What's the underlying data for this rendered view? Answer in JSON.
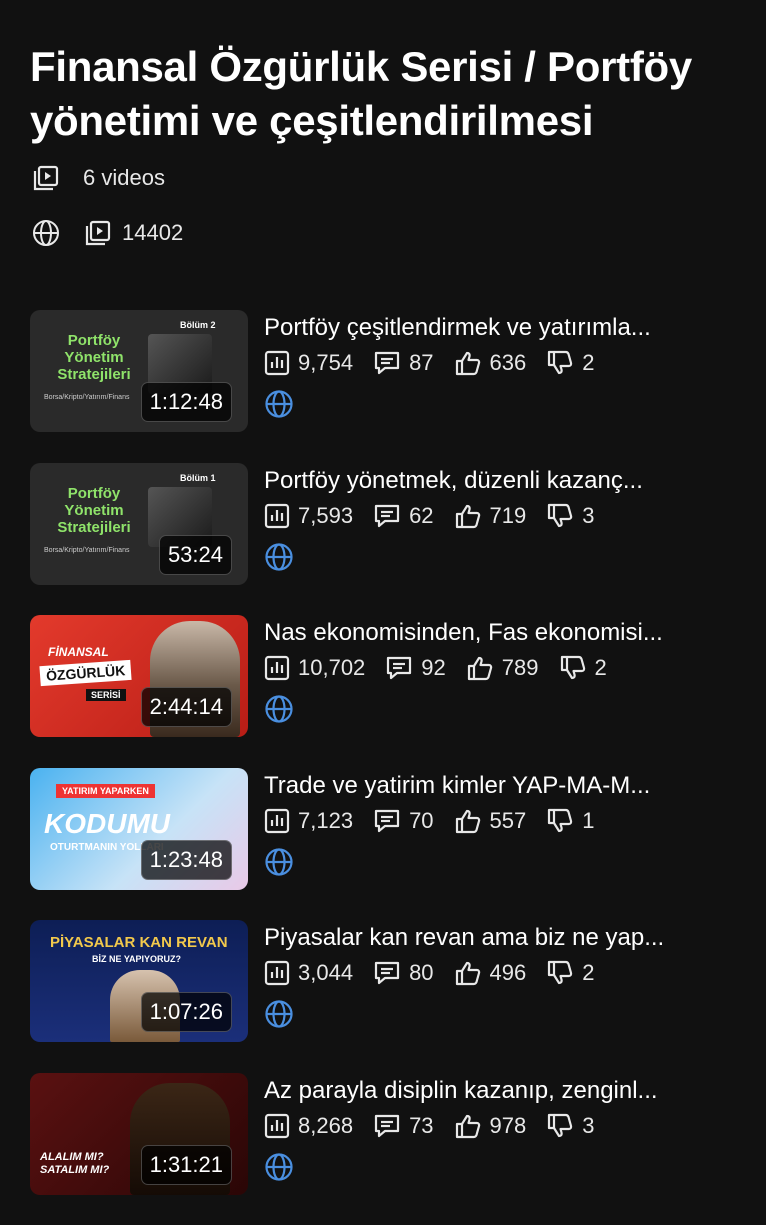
{
  "playlist": {
    "title": "Finansal Özgürlük Serisi / Portföy yönetimi ve çeşitlendirilmesi",
    "video_count": "6 videos",
    "total_views": "14402"
  },
  "colors": {
    "background": "#111111",
    "accent_globe": "#4a8fe0"
  },
  "videos": [
    {
      "title": "Portföy çeşitlendirmek ve yatırımla...",
      "duration": "1:12:48",
      "views": "9,754",
      "comments": "87",
      "likes": "636",
      "dislikes": "2",
      "thumb": {
        "style": "gray",
        "headline": "Portföy Yönetim Stratejileri",
        "badge": "Bölüm 2",
        "footer": "Borsa/Kripto/Yatırım/Finans"
      }
    },
    {
      "title": "Portföy yönetmek, düzenli kazanç...",
      "duration": "53:24",
      "views": "7,593",
      "comments": "62",
      "likes": "719",
      "dislikes": "3",
      "thumb": {
        "style": "gray",
        "headline": "Portföy Yönetim Stratejileri",
        "badge": "Bölüm 1",
        "footer": "Borsa/Kripto/Yatırım/Finans"
      }
    },
    {
      "title": "Nas ekonomisinden, Fas ekonomisi...",
      "duration": "2:44:14",
      "views": "10,702",
      "comments": "92",
      "likes": "789",
      "dislikes": "2",
      "thumb": {
        "style": "red",
        "headline": "FİNANSAL",
        "sub": "ÖZGÜRLÜK",
        "sub2": "SERİSİ"
      }
    },
    {
      "title": "Trade ve yatirim kimler YAP-MA-M...",
      "duration": "1:23:48",
      "views": "7,123",
      "comments": "70",
      "likes": "557",
      "dislikes": "1",
      "thumb": {
        "style": "blue",
        "headline": "YATIRIM YAPARKEN",
        "sub": "KODUMU",
        "sub2": "OTURTMANIN YOLLARI"
      }
    },
    {
      "title": "Piyasalar kan revan ama biz ne yap...",
      "duration": "1:07:26",
      "views": "3,044",
      "comments": "80",
      "likes": "496",
      "dislikes": "2",
      "thumb": {
        "style": "navy",
        "headline": "PİYASALAR KAN REVAN",
        "sub": "BİZ NE YAPIYORUZ?"
      }
    },
    {
      "title": "Az parayla disiplin kazanıp, zenginl...",
      "duration": "1:31:21",
      "views": "8,268",
      "comments": "73",
      "likes": "978",
      "dislikes": "3",
      "thumb": {
        "style": "dark",
        "headline": "ALALIM MI? SATALIM MI?"
      }
    }
  ],
  "icons": {
    "videos": "playlist-icon",
    "privacy": "globe-icon",
    "views": "bar-chart-icon",
    "comments": "comment-icon",
    "likes": "thumbs-up-icon",
    "dislikes": "thumbs-down-icon"
  }
}
